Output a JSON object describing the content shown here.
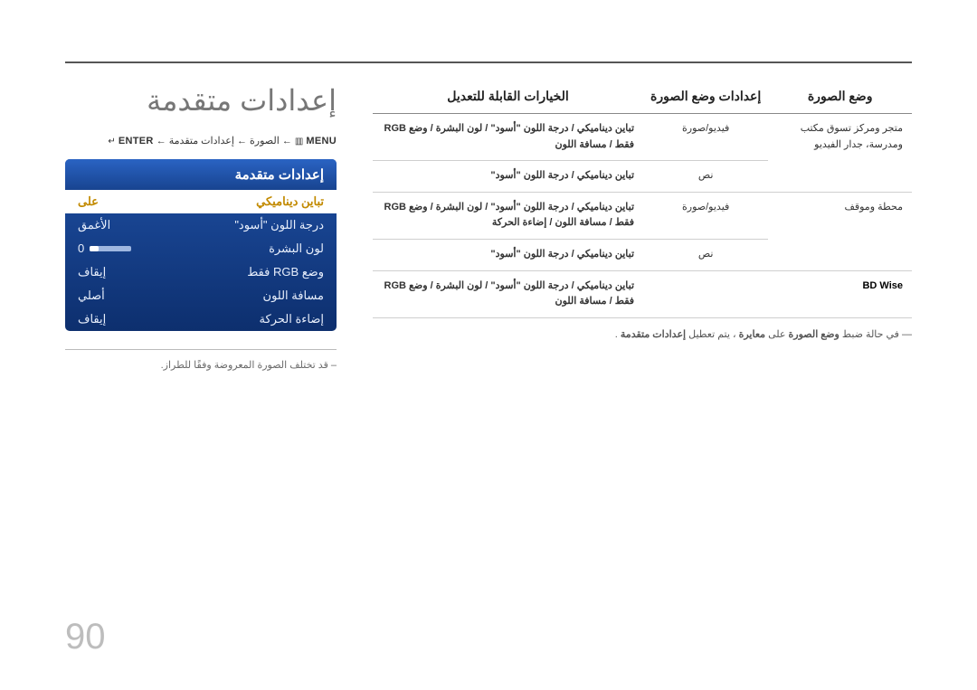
{
  "page_number": "90",
  "page_title": "إعدادات متقدمة",
  "breadcrumb": {
    "menu_label": "MENU",
    "menu_icon": "▥",
    "step1": "الصورة",
    "step2": "إعدادات متقدمة",
    "enter_label": "ENTER",
    "enter_icon": "↵",
    "arrow": "←"
  },
  "osd": {
    "title": "إعدادات متقدمة",
    "rows": [
      {
        "label": "تباين ديناميكي",
        "value": "على",
        "selected": true
      },
      {
        "label": "درجة اللون \"أسود\"",
        "value": "الأغمق"
      },
      {
        "label": "لون البشرة",
        "value": "0",
        "slider": true
      },
      {
        "label": "وضع RGB فقط",
        "value": "إيقاف"
      },
      {
        "label": "مسافة اللون",
        "value": "أصلي"
      },
      {
        "label": "إضاءة الحركة",
        "value": "إيقاف"
      }
    ]
  },
  "foot_note": "–  قد تختلف الصورة المعروضة وفقًا للطراز.",
  "table": {
    "headers": {
      "mode": "وضع الصورة",
      "settings": "إعدادات وضع الصورة",
      "options": "الخيارات القابلة للتعديل"
    },
    "rows": [
      {
        "mode": "متجر ومركز تسوق مكتب ومدرسة، جدار الفيديو",
        "settings": "فيديو/صورة",
        "options": "تباين ديناميكي / درجة اللون \"أسود\" / لون البشرة / وضع RGB فقط / مسافة اللون"
      },
      {
        "mode": "",
        "settings": "نص",
        "options": "تباين ديناميكي / درجة اللون \"أسود\""
      },
      {
        "mode": "محطة وموقف",
        "settings": "فيديو/صورة",
        "options": "تباين ديناميكي / درجة اللون \"أسود\" / لون البشرة / وضع RGB فقط / مسافة اللون / إضاءة الحركة"
      },
      {
        "mode": "",
        "settings": "نص",
        "options": "تباين ديناميكي / درجة اللون \"أسود\""
      },
      {
        "mode": "BD Wise",
        "settings": "",
        "options": "تباين ديناميكي / درجة اللون \"أسود\" / لون البشرة / وضع RGB فقط / مسافة اللون"
      }
    ]
  },
  "caption": {
    "dash": "― ",
    "t1": "في حالة ضبط ",
    "b1": "وضع الصورة",
    "t2": " على ",
    "b2": "معايرة",
    "t3": "، يتم تعطيل ",
    "b3": "إعدادات متقدمة",
    "t4": "."
  }
}
